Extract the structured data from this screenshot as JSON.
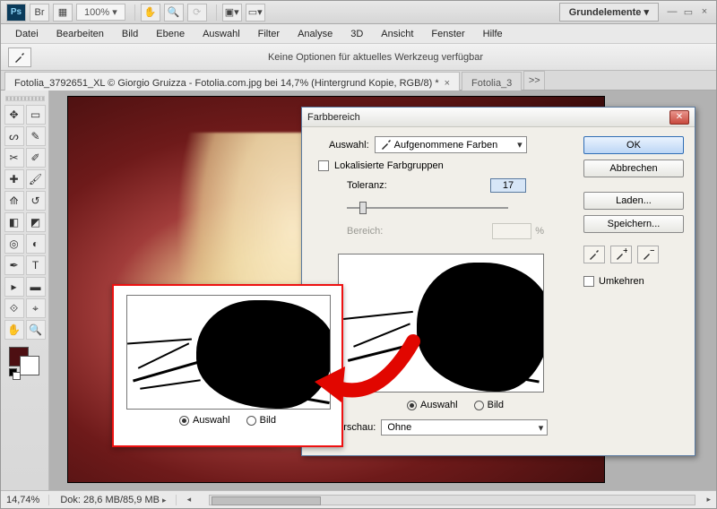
{
  "titlebar": {
    "zoom": "100% ▾",
    "workspace": "Grundelemente ▾"
  },
  "menu": {
    "items": [
      "Datei",
      "Bearbeiten",
      "Bild",
      "Ebene",
      "Auswahl",
      "Filter",
      "Analyse",
      "3D",
      "Ansicht",
      "Fenster",
      "Hilfe"
    ]
  },
  "optionsbar": {
    "message": "Keine Optionen für aktuelles Werkzeug verfügbar"
  },
  "tabs": {
    "active": "Fotolia_3792651_XL © Giorgio Gruizza - Fotolia.com.jpg bei 14,7% (Hintergrund Kopie, RGB/8) *",
    "inactive": "Fotolia_3",
    "more": ">>"
  },
  "status": {
    "zoom": "14,74%",
    "doc": "Dok: 28,6 MB/85,9 MB"
  },
  "dialog": {
    "title": "Farbbereich",
    "auswahl_label": "Auswahl:",
    "auswahl_value": "Aufgenommene Farben",
    "localized_label": "Lokalisierte Farbgruppen",
    "toleranz_label": "Toleranz:",
    "toleranz_value": "17",
    "bereich_label": "Bereich:",
    "bereich_unit": "%",
    "radio_auswahl": "Auswahl",
    "radio_bild": "Bild",
    "vorschau_label": "wahlvorschau:",
    "vorschau_value": "Ohne",
    "btn_ok": "OK",
    "btn_cancel": "Abbrechen",
    "btn_load": "Laden...",
    "btn_save": "Speichern...",
    "invert_label": "Umkehren"
  },
  "callout": {
    "radio_auswahl": "Auswahl",
    "radio_bild": "Bild"
  }
}
